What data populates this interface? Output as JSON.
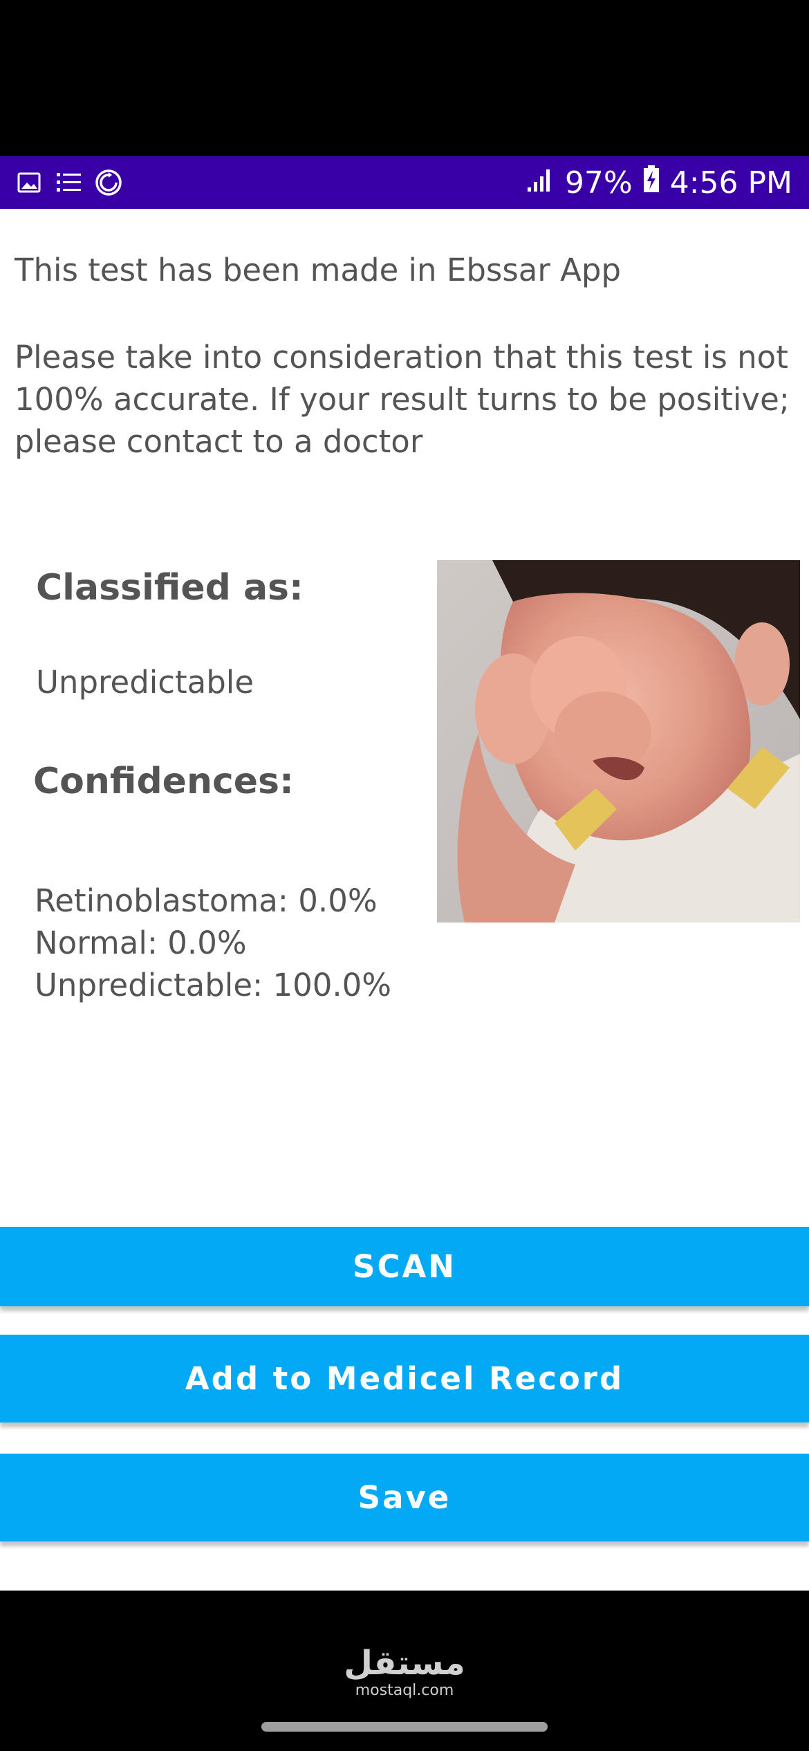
{
  "status_bar": {
    "icons_left": [
      "gallery-icon",
      "list-icon",
      "sync-icon"
    ],
    "battery": "97%",
    "time": "4:56 PM"
  },
  "content": {
    "intro_line": "This test has been made in Ebssar App",
    "disclaimer": "Please take into consideration that this test is not 100% accurate. If your result turns to be positive; please contact to a doctor",
    "classified_heading": "Classified as:",
    "classified_value": "Unpredictable",
    "confidences_heading": "Confidences:",
    "confidences": [
      "Retinoblastoma: 0.0%",
      "Normal: 0.0%",
      "Unpredictable: 100.0%"
    ]
  },
  "buttons": {
    "scan": "SCAN",
    "add_record": "Add to Medicel Record",
    "save": "Save"
  },
  "watermark": {
    "arabic": "مستقل",
    "latin": "mostaql.com"
  },
  "colors": {
    "status_bar": "#3a00a8",
    "button": "#03a9f4",
    "text": "#545454"
  }
}
